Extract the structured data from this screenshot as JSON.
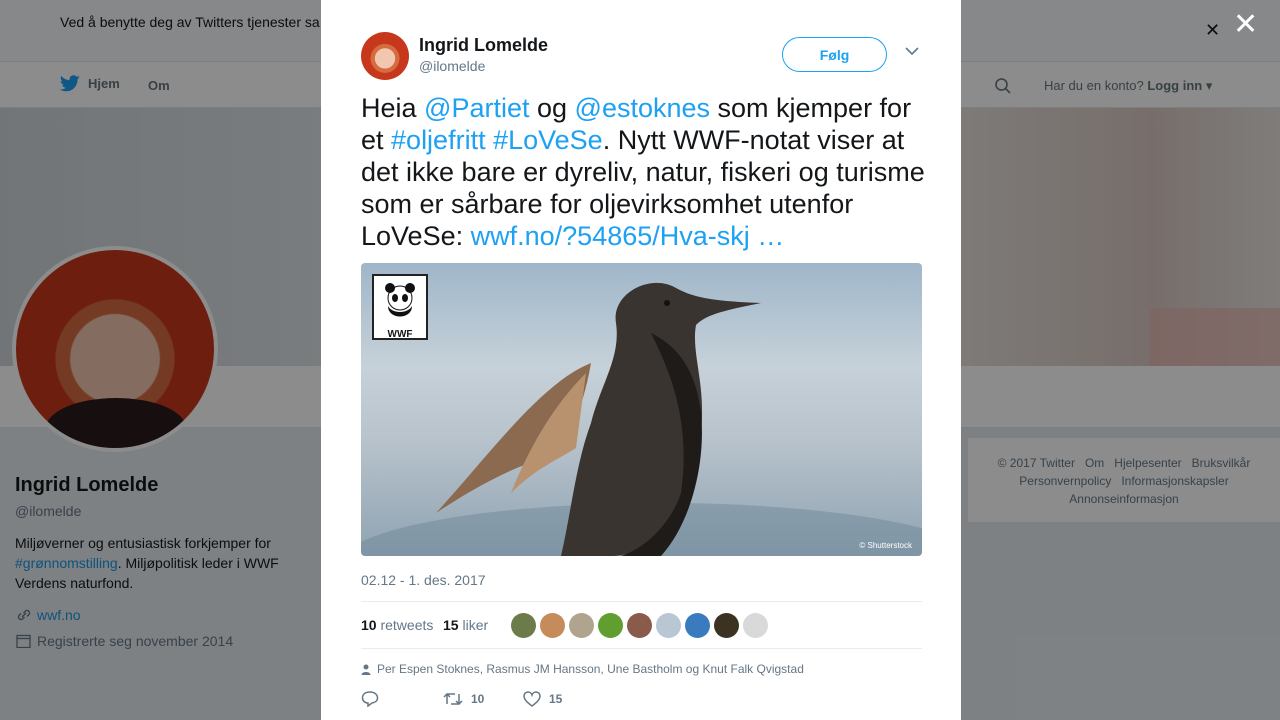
{
  "cookie": {
    "text": "Ved å benytte deg av Twitters tjenester sa                                                                                                                                  samarbeidspartnere opererer globalt, og bruker informasjonskapsler til b"
  },
  "nav": {
    "home": "Hjem",
    "about": "Om",
    "login_prompt": "Har du en konto?",
    "login": "Logg inn"
  },
  "profile": {
    "name": "Ingrid Lomelde",
    "handle": "@ilomelde",
    "bio_before": "Miljøverner og entusiastisk forkjemper for ",
    "bio_hashtag": "#grønnomstilling",
    "bio_after": ". Miljøpolitisk leder i WWF Verdens naturfond.",
    "website": "wwf.no",
    "joined": "Registrerte seg november 2014"
  },
  "footer": {
    "items": [
      "© 2017 Twitter",
      "Om",
      "Hjelpesenter",
      "Bruksvilkår",
      "Personvernpolicy",
      "Informasjonskapsler",
      "Annonseinformasjon"
    ]
  },
  "tweet": {
    "author_name": "Ingrid Lomelde",
    "author_handle": "@ilomelde",
    "follow_label": "Følg",
    "text": {
      "t1": "Heia ",
      "mention1": "@Partiet",
      "t2": " og ",
      "mention2": "@estoknes",
      "t3": " som kjemper for et ",
      "hashtag1": "#oljefritt",
      "t4": " ",
      "hashtag2": "#LoVeSe",
      "t5": ". Nytt WWF-notat viser at det ikke bare er dyreliv, natur, fiskeri og turisme som er sårbare for oljevirksomhet utenfor LoVeSe: ",
      "link": "wwf.no/?54865/Hva-skj …"
    },
    "media_logo_text": "WWF",
    "media_credit": "© Shutterstock",
    "timestamp": "02.12 - 1. des. 2017",
    "retweets_count": "10",
    "retweets_label": "retweets",
    "likes_count": "15",
    "likes_label": "liker",
    "liker_face_colors": [
      "#6b7b4a",
      "#c58b5a",
      "#b0a48e",
      "#5f9e2f",
      "#8a5a4a",
      "#b9c6d3",
      "#3a7bbf",
      "#3b3222",
      "#d9d9d9"
    ],
    "liked_by": "Per Espen Stoknes, Rasmus JM Hansson, Une Bastholm og Knut Falk Qvigstad",
    "action_retweet_count": "10",
    "action_like_count": "15"
  },
  "colors": {
    "accent": "#1da1f2",
    "overlay": "rgba(0,0,0,0.45)"
  }
}
